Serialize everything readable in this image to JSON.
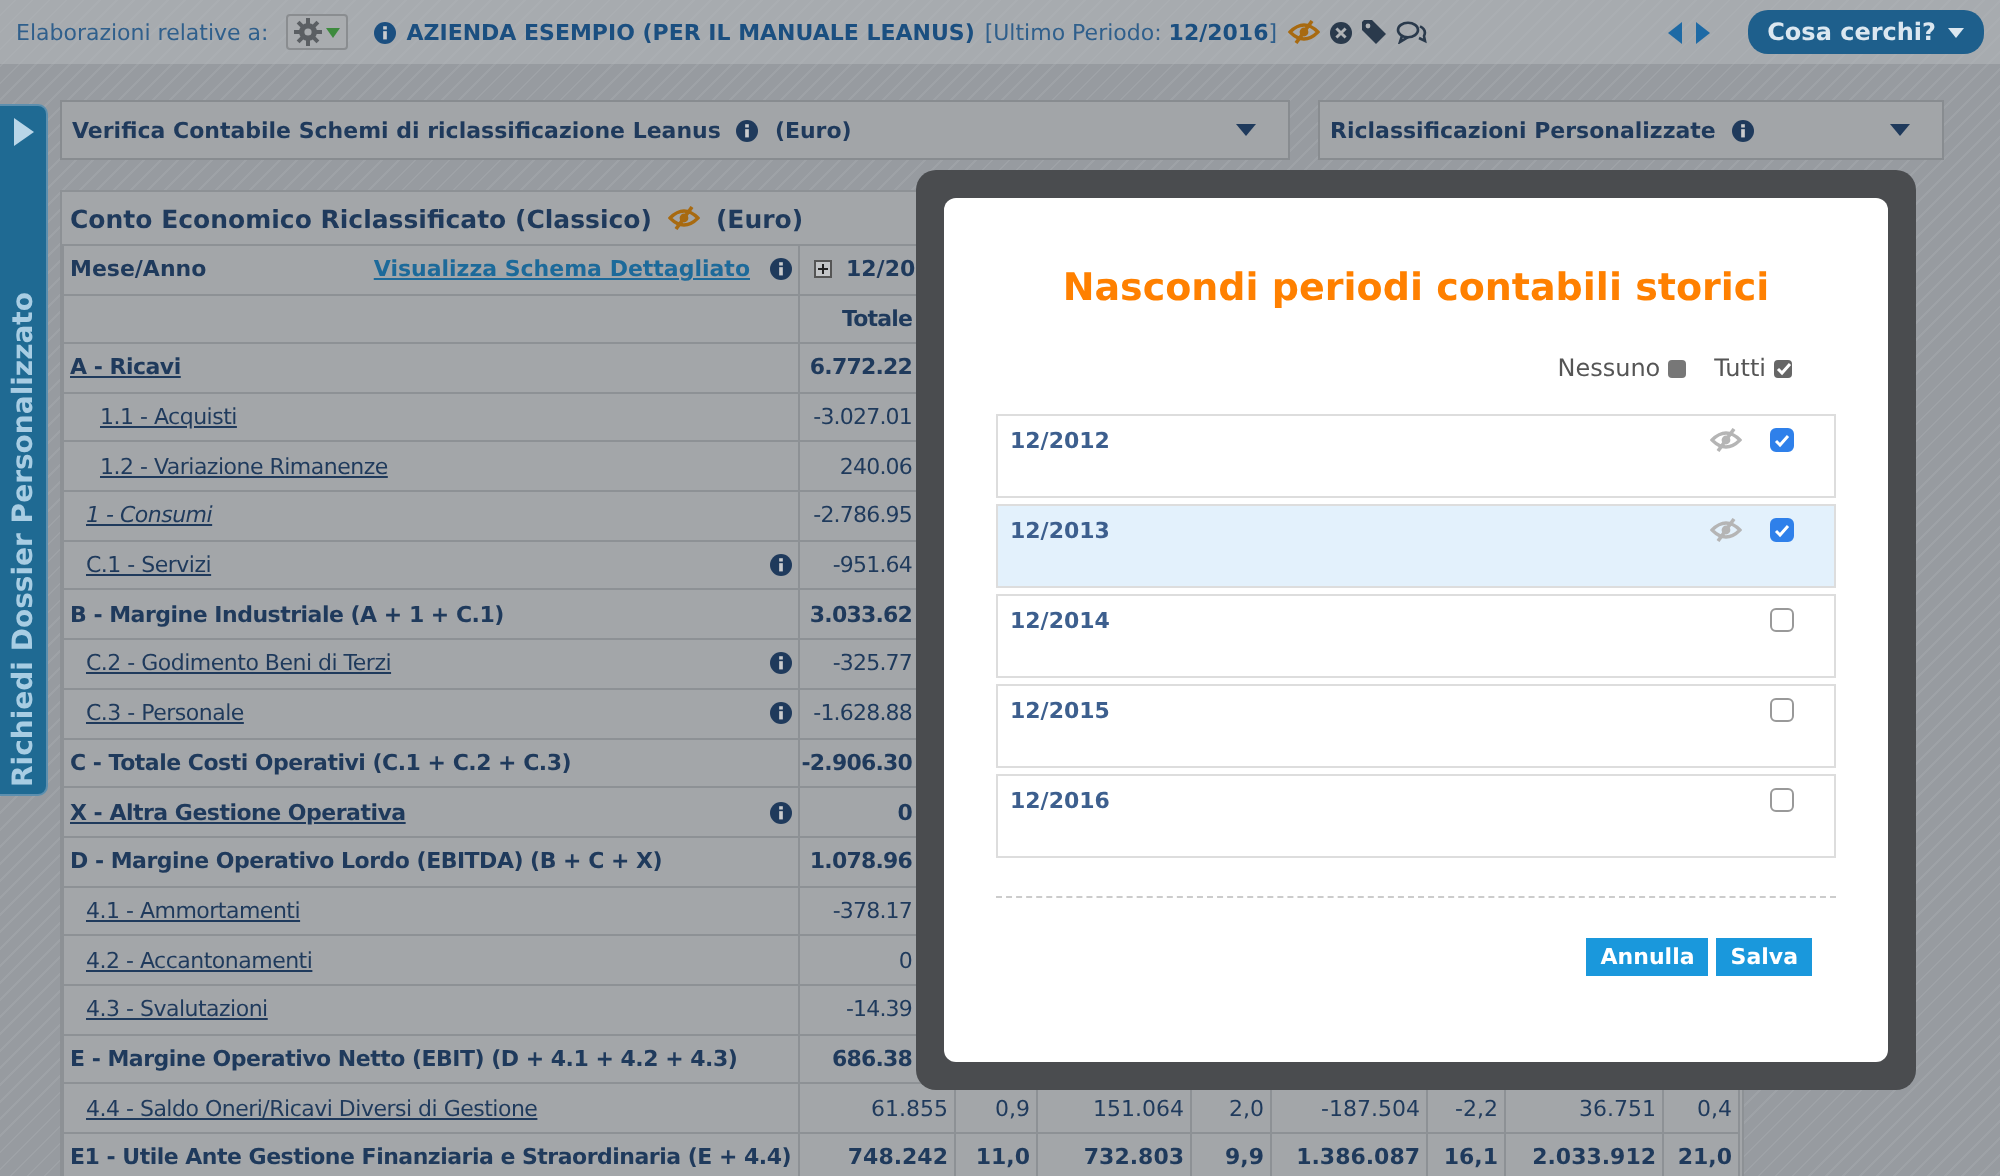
{
  "top_bar": {
    "label": "Elaborazioni relative a:",
    "company": "AZIENDA ESEMPIO (PER IL MANUALE LEANUS)",
    "period": "[Ultimo Periodo: **12/2016**]",
    "search_button": "Cosa cerchi?"
  },
  "side_tab": {
    "label": "Richiedi Dossier Personalizzato"
  },
  "dropdowns": [
    {
      "label": "Verifica Contabile Schemi di riclassificazione Leanus",
      "unit": "(Euro)"
    },
    {
      "label": "Riclassificazioni Personalizzate"
    }
  ],
  "report": {
    "title": "Conto Economico Riclassificato (Classico)",
    "unit": "(Euro)",
    "header": {
      "period_label": "Mese/Anno",
      "link": "Visualizza Schema Dettagliato",
      "period": "12/20",
      "column": "Totale"
    },
    "rows": [
      {
        "label": "A - Ricavi",
        "kind": "total-link",
        "info": false,
        "values": [
          "6.772.22"
        ]
      },
      {
        "label": "1.1 - Acquisti",
        "kind": "subitem",
        "info": false,
        "values": [
          "-3.027.01"
        ]
      },
      {
        "label": "1.2 - Variazione Rimanenze",
        "kind": "subitem",
        "info": false,
        "values": [
          "240.06"
        ]
      },
      {
        "label": "1 - Consumi",
        "kind": "subtotal",
        "info": false,
        "values": [
          "-2.786.95"
        ]
      },
      {
        "label": "C.1 - Servizi",
        "kind": "item",
        "info": true,
        "values": [
          "-951.64"
        ]
      },
      {
        "label": "B - Margine Industriale (A + 1 + C.1)",
        "kind": "sum",
        "info": false,
        "values": [
          "3.033.62"
        ]
      },
      {
        "label": "C.2 - Godimento Beni di Terzi",
        "kind": "item",
        "info": true,
        "values": [
          "-325.77"
        ]
      },
      {
        "label": "C.3 - Personale",
        "kind": "item",
        "info": true,
        "values": [
          "-1.628.88"
        ]
      },
      {
        "label": "C - Totale Costi Operativi (C.1 + C.2 + C.3)",
        "kind": "sum",
        "info": false,
        "values": [
          "-2.906.30"
        ]
      },
      {
        "label": "X - Altra Gestione Operativa",
        "kind": "total-link",
        "info": true,
        "values": [
          "0"
        ]
      },
      {
        "label": "D - Margine Operativo Lordo (EBITDA) (B + C + X)",
        "kind": "sum",
        "info": false,
        "values": [
          "1.078.96"
        ]
      },
      {
        "label": "4.1 - Ammortamenti",
        "kind": "item",
        "info": false,
        "values": [
          "-378.17"
        ]
      },
      {
        "label": "4.2 - Accantonamenti",
        "kind": "item",
        "info": false,
        "values": [
          "0"
        ]
      },
      {
        "label": "4.3 - Svalutazioni",
        "kind": "item",
        "info": false,
        "values": [
          "-14.39"
        ]
      },
      {
        "label": "E - Margine Operativo Netto (EBIT) (D + 4.1 + 4.2 + 4.3)",
        "kind": "sum",
        "info": false,
        "values": [
          "686.38"
        ]
      },
      {
        "label": "4.4 - Saldo Oneri/Ricavi Diversi di Gestione",
        "kind": "item",
        "info": false,
        "values": [
          "61.855",
          "0,9",
          "151.064",
          "2,0",
          "-187.504",
          "-2,2",
          "36.751",
          "0,4"
        ]
      },
      {
        "label": "E1 - Utile Ante Gestione Finanziaria e Straordinaria (E + 4.4)",
        "kind": "sum",
        "info": false,
        "values": [
          "748.242",
          "11,0",
          "732.803",
          "9,9",
          "1.386.087",
          "16,1",
          "2.033.912",
          "21,0"
        ]
      }
    ]
  },
  "modal": {
    "title": "Nascondi periodi contabili storici",
    "none": {
      "label": "Nessuno",
      "checked": false
    },
    "all": {
      "label": "Tutti",
      "checked": true
    },
    "periods": [
      {
        "label": "12/2012",
        "checked": true,
        "selected": false
      },
      {
        "label": "12/2013",
        "checked": true,
        "selected": true
      },
      {
        "label": "12/2014",
        "checked": false,
        "selected": false
      },
      {
        "label": "12/2015",
        "checked": false,
        "selected": false
      },
      {
        "label": "12/2016",
        "checked": false,
        "selected": false
      }
    ],
    "buttons": [
      "Annulla",
      "Salva"
    ]
  }
}
